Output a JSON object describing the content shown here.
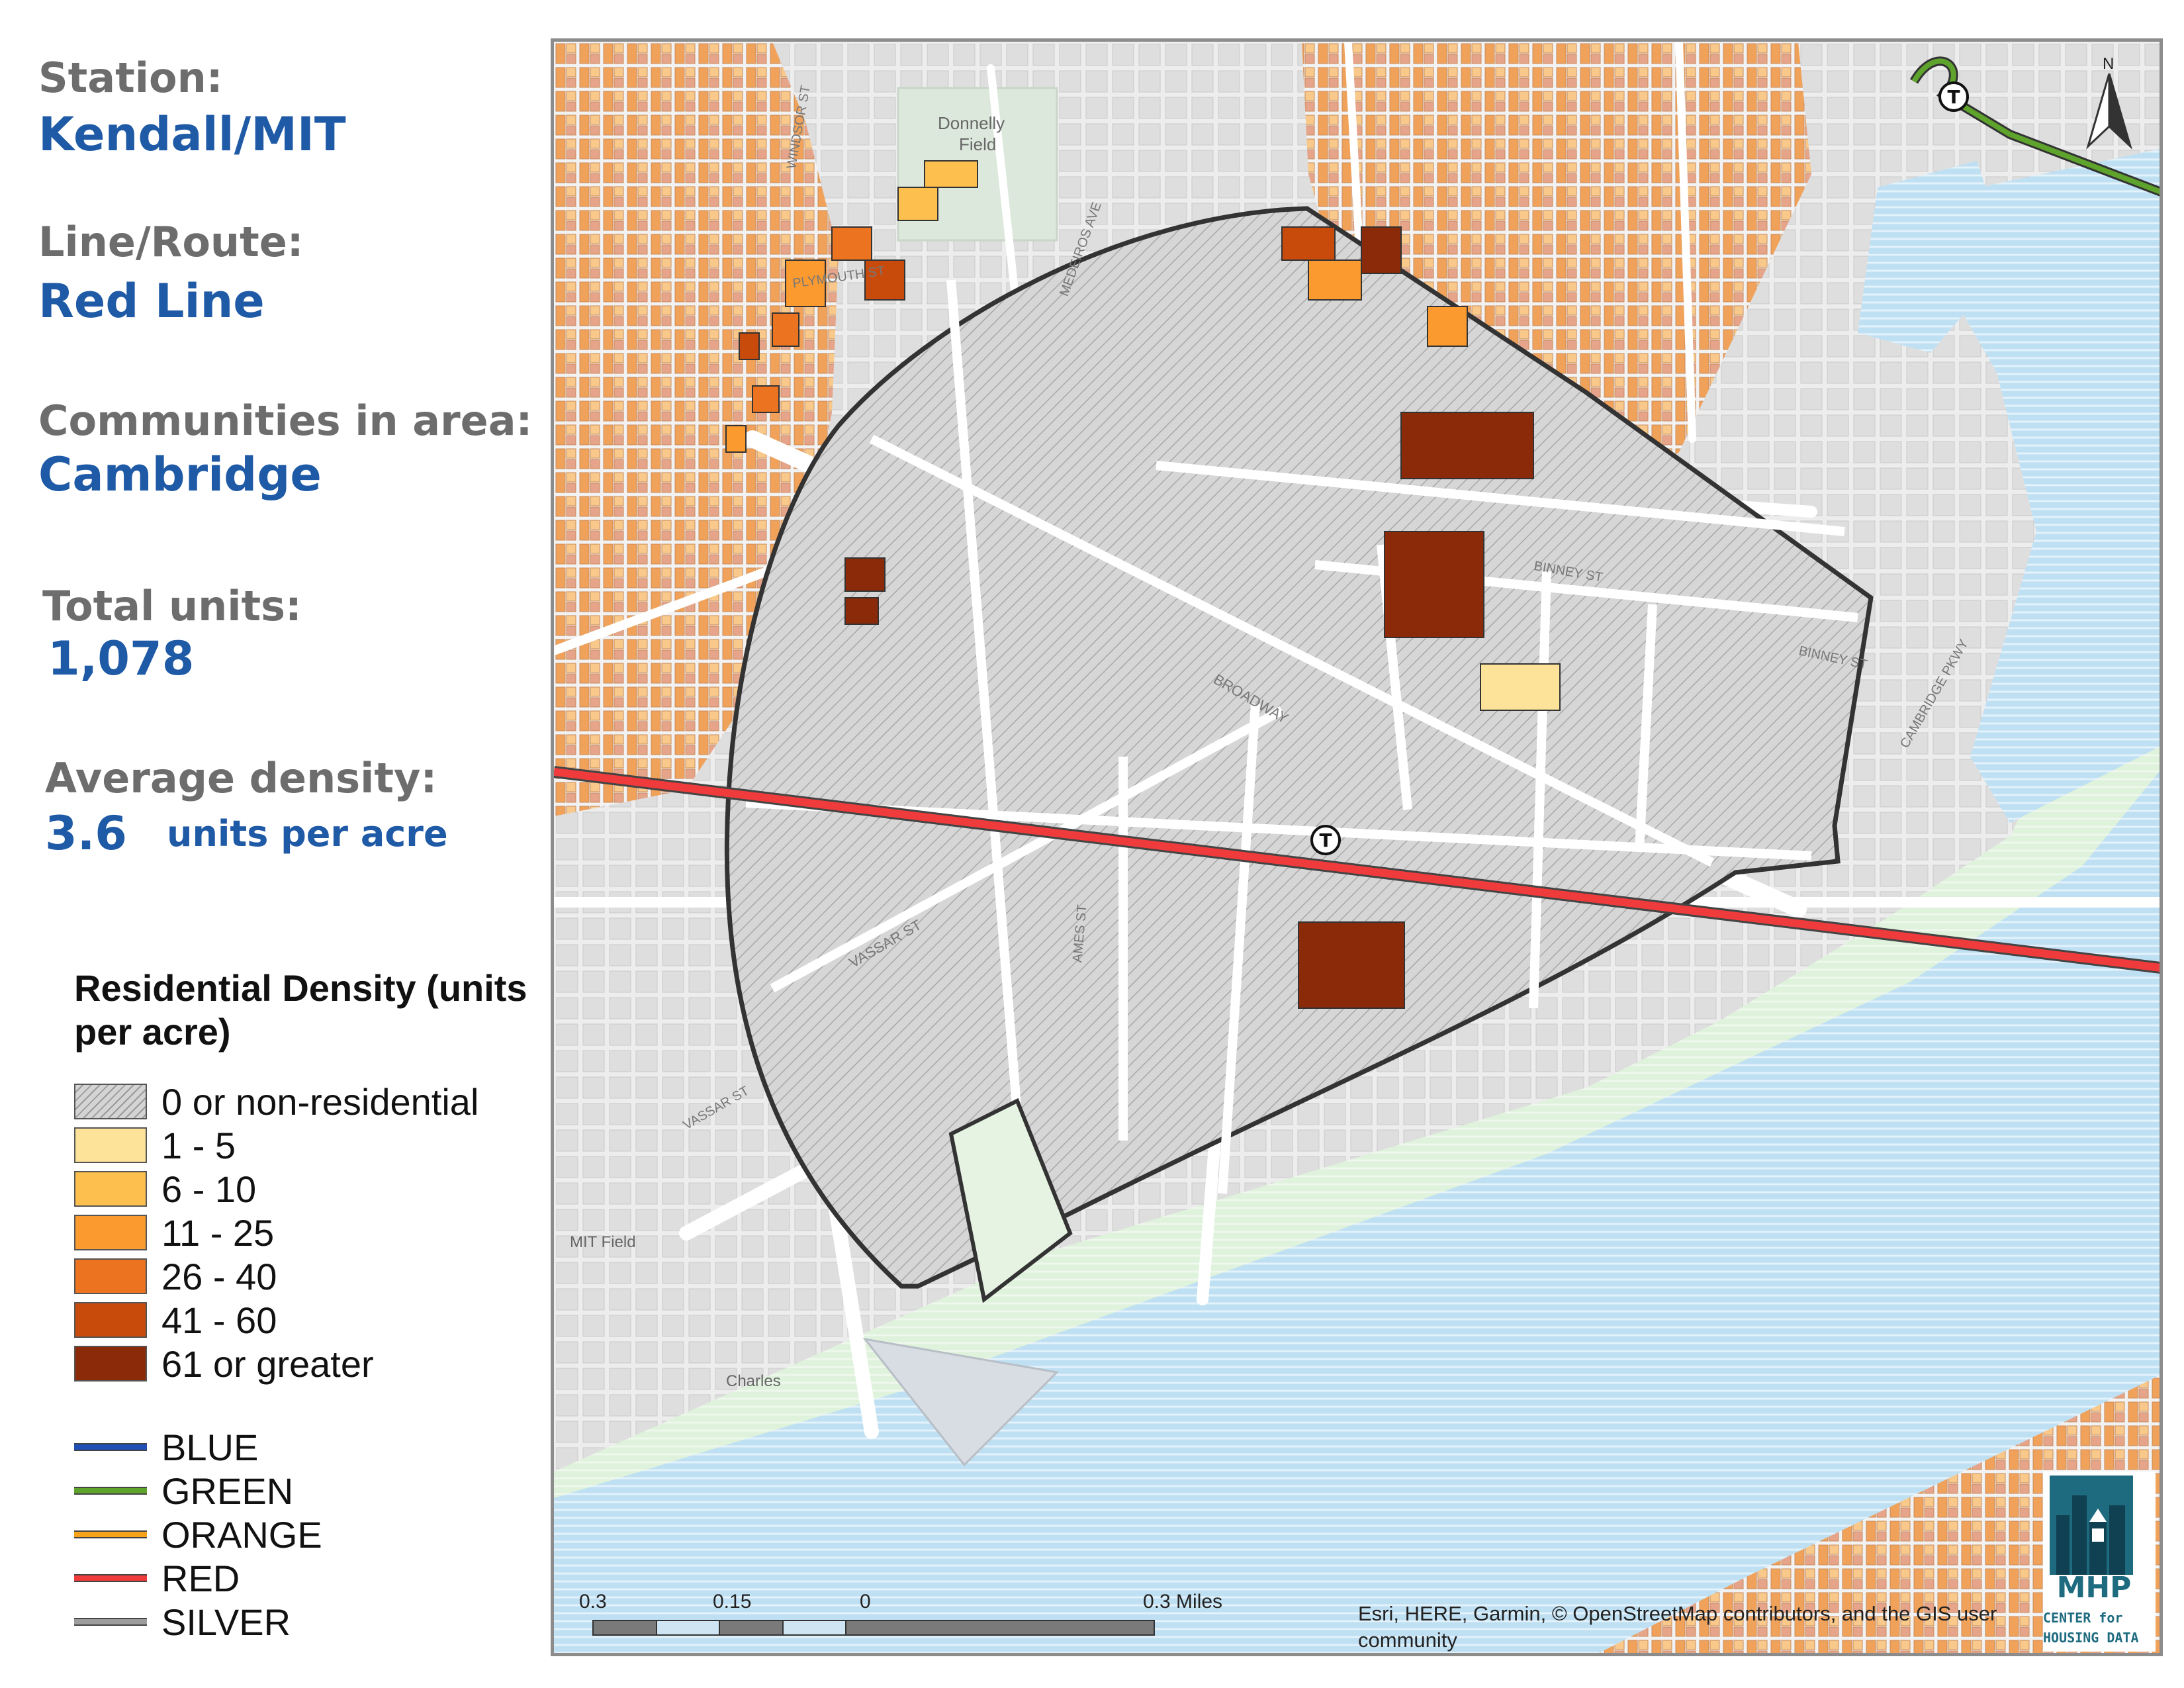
{
  "info": {
    "station_label": "Station:",
    "station_value": "Kendall/MIT",
    "line_label": "Line/Route:",
    "line_value": "Red Line",
    "communities_label": "Communities in area:",
    "communities_value": "Cambridge",
    "units_label": "Total units:",
    "units_value": "1,078",
    "density_label": "Average density:",
    "density_value": "3.6",
    "density_unit": "units per acre"
  },
  "legend": {
    "title": "Residential Density (units per acre)",
    "density_classes": [
      {
        "label": "0 or non-residential",
        "color": "#d4d4d4"
      },
      {
        "label": "1 - 5",
        "color": "#fde29a"
      },
      {
        "label": "6 - 10",
        "color": "#fdc04f"
      },
      {
        "label": "11 - 25",
        "color": "#fb9a2f"
      },
      {
        "label": "26 - 40",
        "color": "#ec7420"
      },
      {
        "label": "41 - 60",
        "color": "#c94b0c"
      },
      {
        "label": "61 or greater",
        "color": "#8b2a08"
      }
    ],
    "transit_lines": [
      {
        "label": "BLUE",
        "color": "#1f4fb7"
      },
      {
        "label": "GREEN",
        "color": "#5ea32b"
      },
      {
        "label": "ORANGE",
        "color": "#f6a21a"
      },
      {
        "label": "RED",
        "color": "#ef3b3b"
      },
      {
        "label": "SILVER",
        "color": "#9d9d9d"
      }
    ]
  },
  "map": {
    "street_labels": [
      "Donnelly",
      "Field",
      "WINDSOR ST",
      "PLYMOUTH ST",
      "MEDEIROS AVE",
      "BINNEY ST",
      "BROADWAY",
      "VASSAR ST",
      "AMES ST",
      "MIT Field",
      "Charles",
      "CAMBRIDGE PKWY",
      "BINNEY ST",
      "VASSAR ST"
    ],
    "north_label": "N",
    "station_marker": "T",
    "scale_labels": [
      "0.3",
      "0.15",
      "0",
      "0.3 Miles"
    ],
    "attribution": "Esri, HERE, Garmin, © OpenStreetMap contributors, and the GIS user community",
    "logo_name": "MHP",
    "logo_sub1": "CENTER for",
    "logo_sub2": "HOUSING DATA"
  }
}
